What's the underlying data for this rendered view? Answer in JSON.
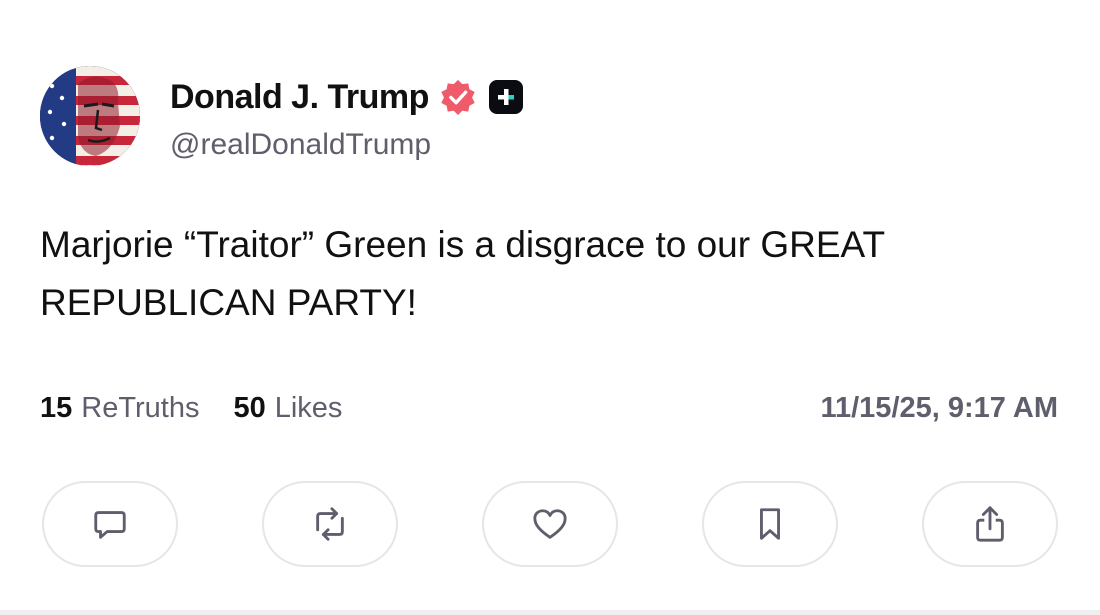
{
  "post": {
    "display_name": "Donald J. Trump",
    "handle": "@realDonaldTrump",
    "text_line1": "Marjorie “Traitor” Green is a disgrace to our GREAT",
    "text_line2": "REPUBLICAN PARTY!",
    "retruths_count": "15",
    "retruths_label": "ReTruths",
    "likes_count": "50",
    "likes_label": "Likes",
    "timestamp": "11/15/25, 9:17 AM"
  },
  "colors": {
    "verified_badge": "#ef5b6b",
    "plus_badge_bg": "#0b0b12",
    "plus_badge_accent": "#27d3c3",
    "muted_text": "#5e5e6c",
    "button_border": "#e6e6ea"
  },
  "icons": {
    "verified": "verified-check-icon",
    "plus": "plus-icon",
    "reply": "comment-icon",
    "retruth": "repost-icon",
    "like": "heart-icon",
    "bookmark": "bookmark-icon",
    "share": "share-icon"
  }
}
